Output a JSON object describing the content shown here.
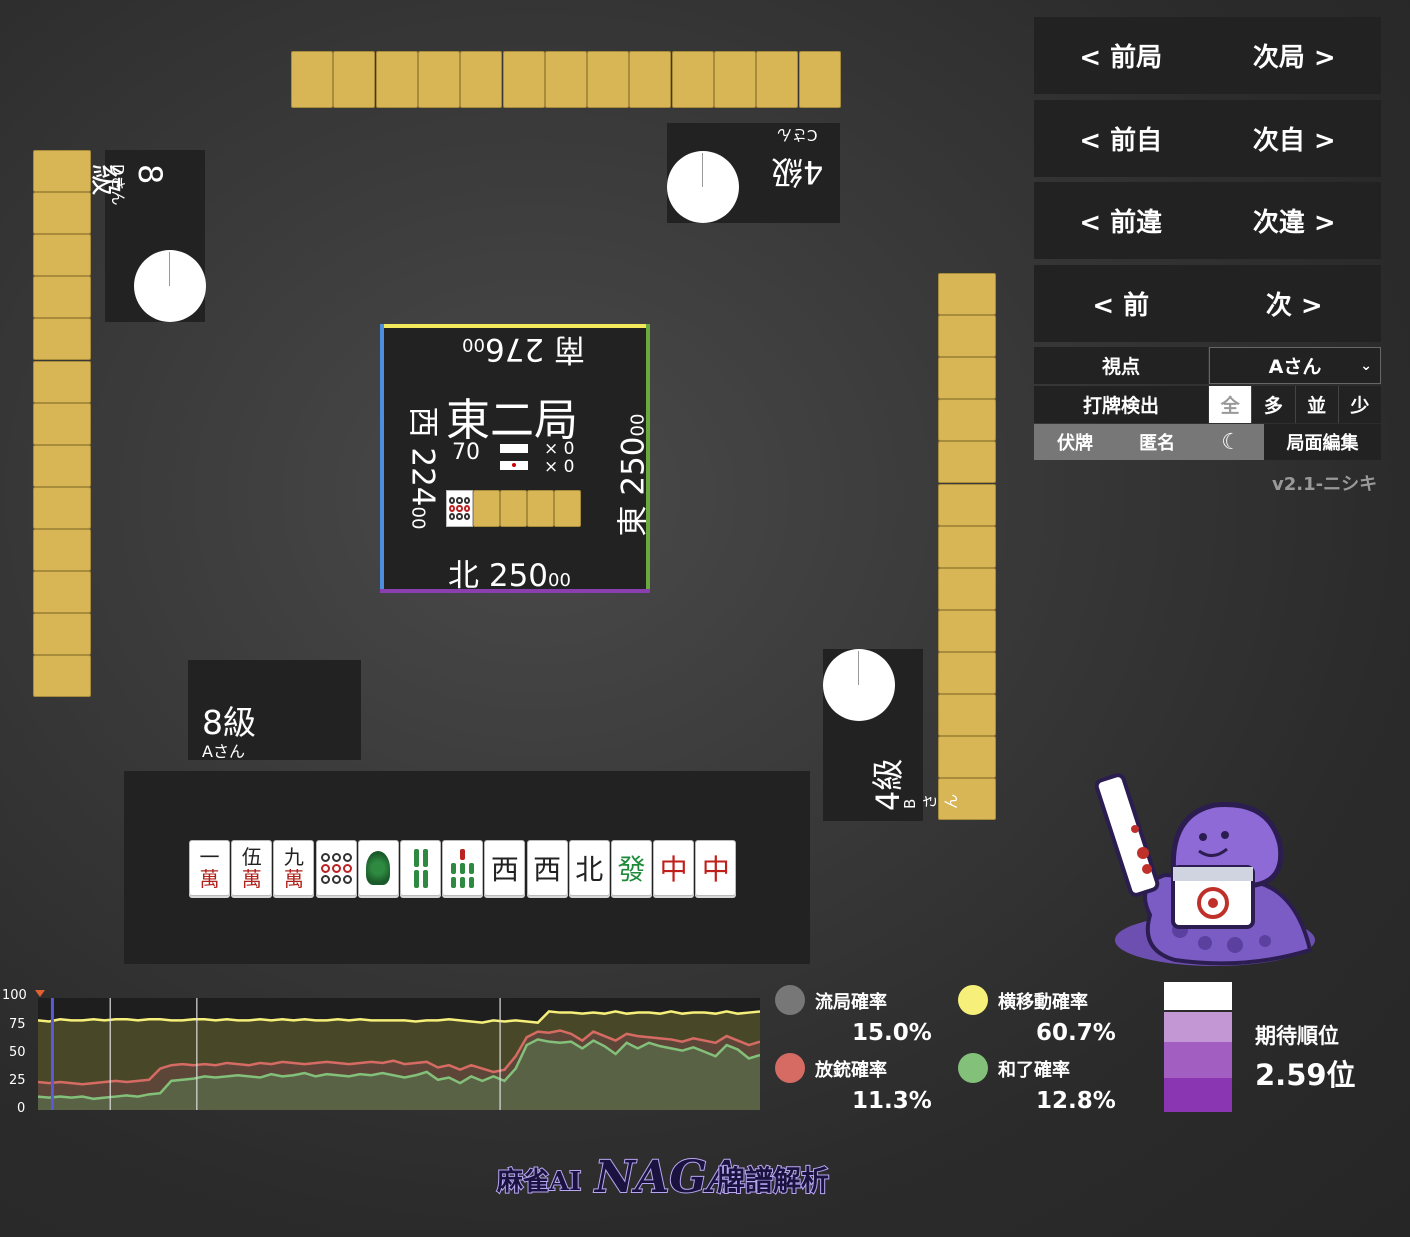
{
  "nav": {
    "prev_round": "< 前局",
    "next_round": "次局 >",
    "prev_self": "< 前自",
    "next_self": "次自 >",
    "prev_diff": "< 前違",
    "next_diff": "次違 >",
    "prev": "< 前",
    "next": "次 >"
  },
  "controls": {
    "viewpoint_label": "視点",
    "viewpoint_value": "Aさん",
    "detect_label": "打牌検出",
    "detect_options": [
      "全",
      "多",
      "並",
      "少"
    ],
    "hidden_tiles": "伏牌",
    "anonymous": "匿名",
    "moon_icon": "☾",
    "edit_board": "局面編集",
    "version": "v2.1-ニシキ"
  },
  "players": {
    "top": {
      "rank": "4級",
      "name": "Cさん"
    },
    "left": {
      "rank": "8級",
      "name": "Dさん"
    },
    "self": {
      "rank": "8級",
      "name": "Aさん"
    },
    "right": {
      "rank": "4級",
      "name": "Bさん"
    }
  },
  "center": {
    "round": "東二局",
    "tiles_left": "70",
    "honba": "× 0",
    "riichi": "× 0",
    "south": "南 276",
    "south_small": "00",
    "west": "西 224",
    "west_small": "00",
    "east": "東 250",
    "east_small": "00",
    "north": "北 250",
    "north_small": "00",
    "colors": {
      "top": "#f3e95a",
      "left": "#4c8fe0",
      "right": "#6aaa3c",
      "bottom": "#8a3fb0"
    }
  },
  "hand": [
    {
      "top": "一",
      "bot": "萬"
    },
    {
      "top": "伍",
      "bot": "萬"
    },
    {
      "top": "九",
      "bot": "萬"
    },
    {
      "kind": "pin9"
    },
    {
      "kind": "sou1"
    },
    {
      "kind": "sou4"
    },
    {
      "kind": "sou7"
    },
    {
      "char": "西"
    },
    {
      "char": "西"
    },
    {
      "char": "北"
    },
    {
      "char": "發",
      "color": "#1e8a3a"
    },
    {
      "char": "中",
      "color": "#c0201a"
    },
    {
      "char": "中",
      "color": "#c0201a"
    }
  ],
  "stats": {
    "ryukyoku_label": "流局確率",
    "ryukyoku_value": "15.0%",
    "yokoido_label": "横移動確率",
    "yokoido_value": "60.7%",
    "houju_label": "放銃確率",
    "houju_value": "11.3%",
    "agari_label": "和了確率",
    "agari_value": "12.8%",
    "expected_label": "期待順位",
    "expected_value": "2.59位",
    "colors": {
      "ryukyoku": "#777777",
      "yokoido": "#f6ef7a",
      "houju": "#d66b64",
      "agari": "#83c07a"
    }
  },
  "chart_data": {
    "type": "line",
    "yticks": [
      "100",
      "75",
      "50",
      "25",
      "0"
    ],
    "ylim": [
      0,
      100
    ],
    "series": [
      {
        "name": "横移動確率",
        "color": "#f6ef7a",
        "values": [
          80,
          79,
          81,
          80,
          80,
          81,
          80,
          81,
          81,
          80,
          81,
          81,
          80,
          80,
          81,
          81,
          80,
          81,
          80,
          80,
          81,
          80,
          81,
          80,
          81,
          80,
          80,
          81,
          80,
          81,
          80,
          80,
          80,
          80,
          79,
          80,
          80,
          81,
          80,
          79,
          78,
          80,
          79,
          80,
          79,
          78,
          88,
          87,
          87,
          86,
          87,
          86,
          88,
          86,
          87,
          87,
          86,
          88,
          86,
          87,
          87,
          86,
          88,
          86,
          87,
          88
        ]
      },
      {
        "name": "放銃確率",
        "color": "#d66b64",
        "values": [
          25,
          24,
          25,
          24,
          23,
          24,
          25,
          26,
          25,
          26,
          27,
          37,
          40,
          41,
          40,
          41,
          40,
          42,
          41,
          40,
          42,
          41,
          43,
          42,
          41,
          42,
          43,
          42,
          41,
          42,
          43,
          42,
          44,
          41,
          42,
          43,
          38,
          40,
          36,
          40,
          37,
          34,
          36,
          48,
          65,
          70,
          69,
          71,
          68,
          62,
          70,
          66,
          62,
          68,
          66,
          65,
          64,
          63,
          61,
          64,
          62,
          60,
          66,
          62,
          58,
          61
        ]
      },
      {
        "name": "和了確率",
        "color": "#83c07a",
        "values": [
          12,
          11,
          12,
          11,
          12,
          10,
          11,
          12,
          13,
          12,
          14,
          15,
          26,
          27,
          28,
          30,
          29,
          30,
          31,
          30,
          29,
          32,
          30,
          31,
          33,
          30,
          32,
          31,
          30,
          32,
          31,
          33,
          31,
          29,
          31,
          34,
          27,
          29,
          24,
          30,
          26,
          30,
          26,
          37,
          58,
          63,
          61,
          60,
          61,
          55,
          62,
          57,
          50,
          60,
          55,
          60,
          57,
          55,
          53,
          56,
          52,
          48,
          58,
          54,
          46,
          49
        ]
      }
    ],
    "round_markers": [
      0.1,
      0.22,
      0.64
    ],
    "current": 0.02
  }
}
